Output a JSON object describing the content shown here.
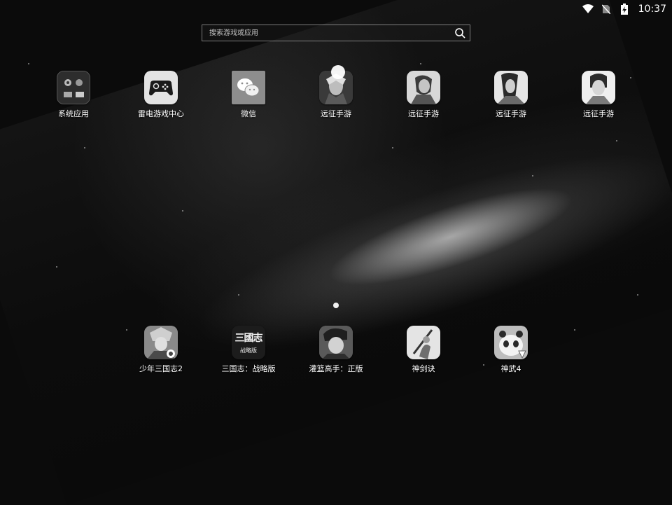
{
  "status_bar": {
    "time": "10:37",
    "icons": [
      "wifi-icon",
      "no-sim-icon",
      "battery-charging-icon"
    ]
  },
  "search": {
    "placeholder": "搜索游戏或应用",
    "icon": "search-icon"
  },
  "apps_top": [
    {
      "label": "系统应用",
      "icon": "system-apps-folder-icon"
    },
    {
      "label": "雷电游戏中心",
      "icon": "leidian-game-center-icon"
    },
    {
      "label": "微信",
      "icon": "wechat-icon"
    },
    {
      "label": "远征手游",
      "icon": "yuanzheng-game-icon"
    },
    {
      "label": "远征手游",
      "icon": "yuanzheng-game-icon"
    },
    {
      "label": "远征手游",
      "icon": "yuanzheng-game-icon"
    },
    {
      "label": "远征手游",
      "icon": "yuanzheng-game-icon"
    }
  ],
  "dock": [
    {
      "label": "少年三国志2",
      "icon": "shaonian-sanguozhi2-icon"
    },
    {
      "label": "三国志：战略版",
      "icon": "sanguozhi-zhanlue-icon",
      "tile_text": "三國志",
      "tile_subtext": "战略版"
    },
    {
      "label": "灌篮高手：正版",
      "icon": "slam-dunk-icon"
    },
    {
      "label": "神剑诀",
      "icon": "shenjianjue-icon"
    },
    {
      "label": "神武4",
      "icon": "shenwu4-icon"
    }
  ]
}
